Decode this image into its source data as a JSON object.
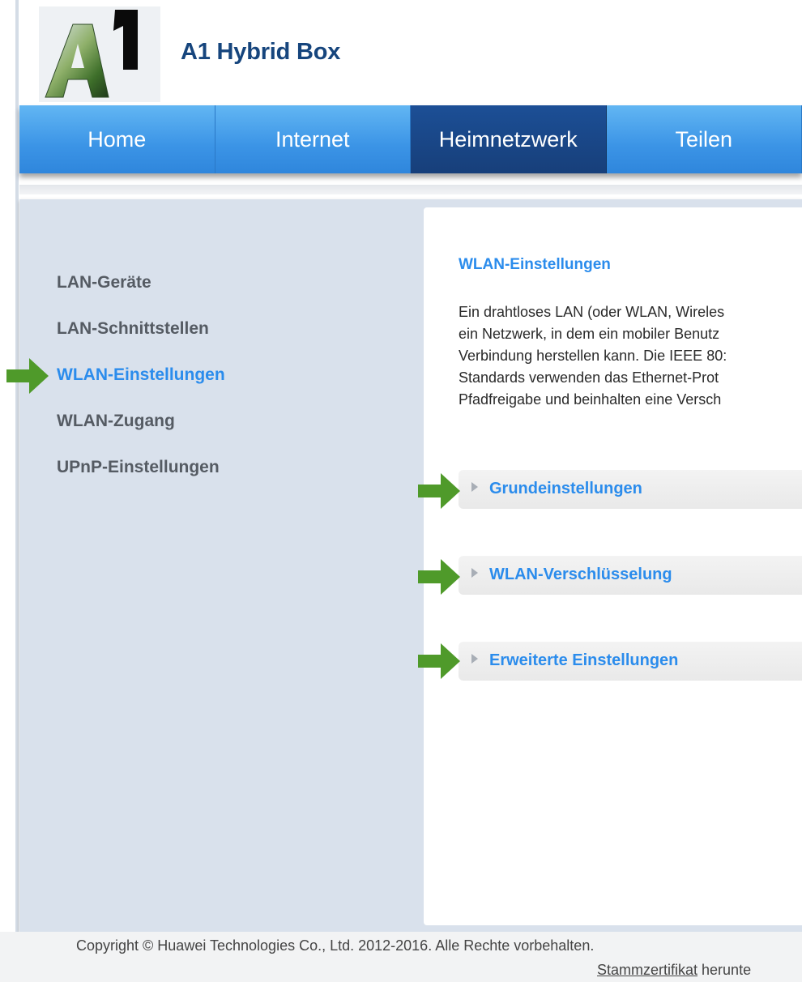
{
  "header": {
    "logo_text": "A1",
    "product_name": "A1 Hybrid Box"
  },
  "nav": {
    "tabs": [
      {
        "label": "Home",
        "active": false
      },
      {
        "label": "Internet",
        "active": false
      },
      {
        "label": "Heimnetzwerk",
        "active": true
      },
      {
        "label": "Teilen",
        "active": false
      }
    ]
  },
  "sidebar": {
    "items": [
      {
        "label": "LAN-Geräte",
        "active": false
      },
      {
        "label": "LAN-Schnittstellen",
        "active": false
      },
      {
        "label": "WLAN-Einstellungen",
        "active": true
      },
      {
        "label": "WLAN-Zugang",
        "active": false
      },
      {
        "label": "UPnP-Einstellungen",
        "active": false
      }
    ]
  },
  "content": {
    "title": "WLAN-Einstellungen",
    "description_lines": [
      "Ein drahtloses LAN (oder WLAN, Wireles",
      "ein Netzwerk, in dem ein mobiler Benutz",
      "Verbindung herstellen kann. Die IEEE 80:",
      "Standards verwenden das Ethernet-Prot",
      "Pfadfreigabe und beinhalten eine Versch"
    ],
    "sections": [
      {
        "label": "Grundeinstellungen"
      },
      {
        "label": "WLAN-Verschlüsselung"
      },
      {
        "label": "Erweiterte Einstellungen"
      }
    ]
  },
  "footer": {
    "copyright": "Copyright © Huawei Technologies Co., Ltd. 2012-2016. Alle Rechte vorbehalten.",
    "cert_link": "Stammzertifikat",
    "cert_suffix": " herunte"
  },
  "colors": {
    "accent": "#2b8cec",
    "nav_blue": "#3b94e6",
    "nav_active": "#1c4f96",
    "annotation_arrow": "#4f9a2a"
  },
  "annotations": {
    "arrow_icon": "green-arrow-right-icon"
  }
}
